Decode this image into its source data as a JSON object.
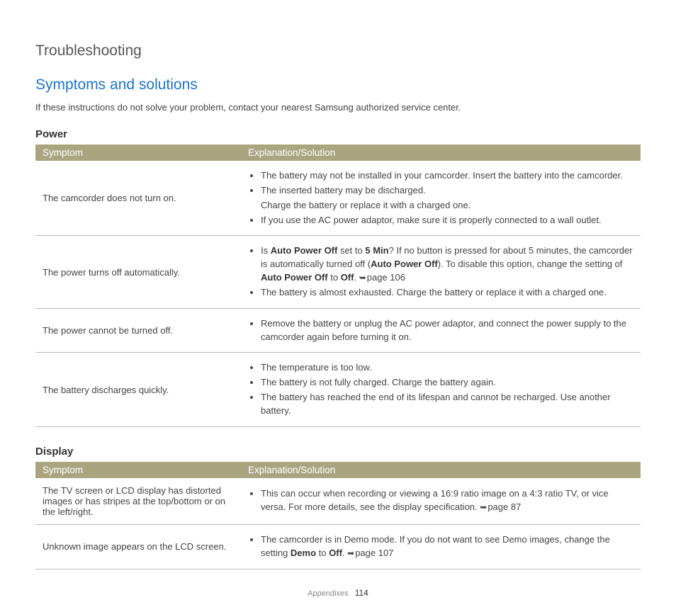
{
  "pageTitle": "Troubleshooting",
  "sectionTitle": "Symptoms and solutions",
  "intro": "If these instructions do not solve your problem, contact your nearest Samsung authorized service center.",
  "tables": [
    {
      "heading": "Power",
      "col1": "Symptom",
      "col2": "Explanation/Solution",
      "rows": [
        {
          "symptom": "The camcorder does not turn on.",
          "items": [
            {
              "type": "bullet",
              "text": "The battery may not be installed in your camcorder. Insert the battery into the camcorder."
            },
            {
              "type": "bullet",
              "text": "The inserted battery may be discharged."
            },
            {
              "type": "plain",
              "text": "Charge the battery or replace it with a charged one."
            },
            {
              "type": "bullet",
              "text": "If you use the AC power adaptor, make sure it is properly connected to a wall outlet."
            }
          ]
        },
        {
          "symptom": "The power turns off automatically.",
          "items": [
            {
              "type": "bullet",
              "segments": [
                {
                  "t": "Is "
                },
                {
                  "t": "Auto Power Off",
                  "b": true
                },
                {
                  "t": " set to "
                },
                {
                  "t": "5 Min",
                  "b": true
                },
                {
                  "t": "? If no button is pressed for about 5 minutes, the camcorder is automatically turned off ("
                },
                {
                  "t": "Auto Power Off",
                  "b": true
                },
                {
                  "t": "). To disable this option, change the setting of "
                },
                {
                  "t": "Auto Power Off",
                  "b": true
                },
                {
                  "t": " to "
                },
                {
                  "t": "Off",
                  "b": true
                },
                {
                  "t": ". "
                },
                {
                  "arrow": true
                },
                {
                  "t": "page 106"
                }
              ]
            },
            {
              "type": "bullet",
              "text": "The battery is almost exhausted. Charge the battery or replace it with a charged one."
            }
          ]
        },
        {
          "symptom": "The power cannot be turned off.",
          "items": [
            {
              "type": "bullet",
              "text": "Remove the battery or unplug the AC power adaptor, and connect the power supply to the camcorder again before turning it on."
            }
          ]
        },
        {
          "symptom": "The battery discharges quickly.",
          "items": [
            {
              "type": "bullet",
              "text": "The temperature is too low."
            },
            {
              "type": "bullet",
              "text": "The battery is not fully charged. Charge the battery again."
            },
            {
              "type": "bullet",
              "text": "The battery has reached the end of its lifespan and cannot be recharged. Use another battery."
            }
          ]
        }
      ]
    },
    {
      "heading": "Display",
      "col1": "Symptom",
      "col2": "Explanation/Solution",
      "rows": [
        {
          "symptom": "The TV screen or LCD display has distorted images or has stripes at the top/bottom or on the left/right.",
          "items": [
            {
              "type": "bullet",
              "segments": [
                {
                  "t": "This can occur when recording or viewing a 16:9 ratio image on a 4:3 ratio TV, or vice versa. For more details, see the display specification. "
                },
                {
                  "arrow": true
                },
                {
                  "t": "page 87"
                }
              ]
            }
          ]
        },
        {
          "symptom": "Unknown image appears on the LCD screen.",
          "items": [
            {
              "type": "bullet",
              "segments": [
                {
                  "t": "The camcorder is in Demo mode. If you do not want to see Demo images, change the setting "
                },
                {
                  "t": "Demo",
                  "b": true
                },
                {
                  "t": " to "
                },
                {
                  "t": "Off",
                  "b": true
                },
                {
                  "t": ". "
                },
                {
                  "arrow": true
                },
                {
                  "t": "page 107"
                }
              ]
            }
          ]
        }
      ]
    }
  ],
  "footer": {
    "label": "Appendixes",
    "page": "114"
  }
}
